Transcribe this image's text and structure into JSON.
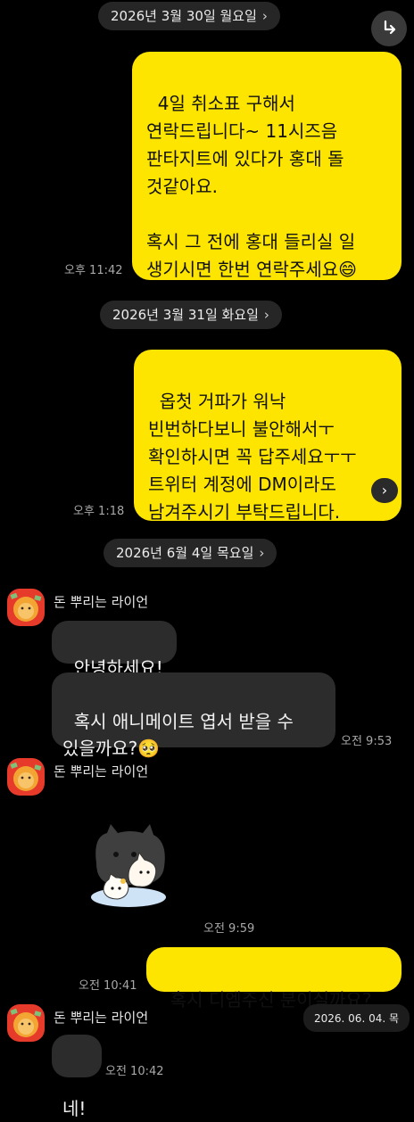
{
  "dates": {
    "d1": "2026년 3월 30일 월요일",
    "d2": "2026년 3월 31일 화요일",
    "d3": "2026년 6월 4일 목요일"
  },
  "messages": {
    "m1": "4일 취소표 구해서\n연락드립니다~ 11시즈음\n판타지트에 있다가 홍대 돌\n것같아요.\n\n혹시 그 전에 홍대 들리실 일\n생기시면 한번 연락주세요😄",
    "m1_time": "오후 11:42",
    "m2": "옵첫 거파가 워낙\n빈번하다보니 불안해서ㅜ\n확인하시면 꼭 답주세요ㅜㅜ\n트위터 계정에 DM이라도\n남겨주시기 부탁드립니다.",
    "m2_time": "오후 1:18",
    "sender_name": "돈 뿌리는 라이언",
    "t1": "안녕하세요!",
    "t2": "혹시 애니메이트 엽서 받을 수\n있을까요?🥺",
    "t2_time": "오전 9:53",
    "sticker_time": "오전 9:59",
    "m3": "혹시 디엠주신 분이실까요?",
    "m3_time": "오전 10:41",
    "t3": "네!",
    "t3_time": "오전 10:42"
  },
  "floating_date": "2026. 06. 04. 목",
  "colors": {
    "my_bubble": "#fee500",
    "their_bubble": "#2c2c2c",
    "background": "#000000"
  },
  "icons": {
    "share": "share-arrow-icon",
    "chevron": "chevron-right-icon"
  }
}
